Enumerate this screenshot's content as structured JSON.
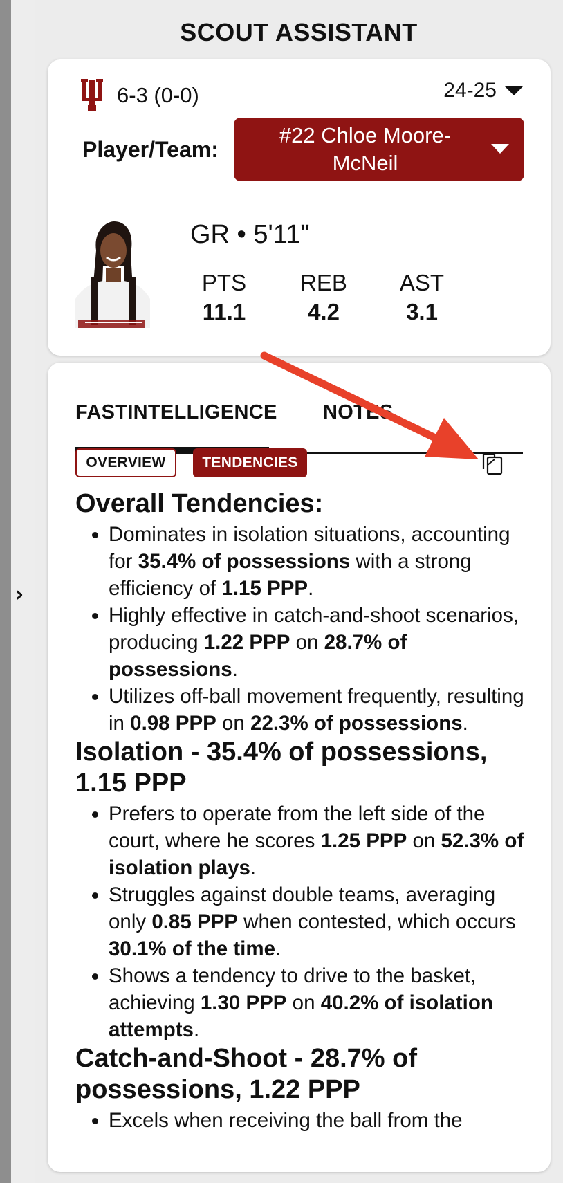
{
  "app": {
    "title": "SCOUT ASSISTANT"
  },
  "team": {
    "record": "6-3 (0-0)",
    "season": "24-25"
  },
  "player_select": {
    "label": "Player/Team:",
    "selected": "#22 Chloe Moore-McNeil"
  },
  "player": {
    "bio": "GR • 5'11\"",
    "stats": [
      {
        "label": "PTS",
        "value": "11.1"
      },
      {
        "label": "REB",
        "value": "4.2"
      },
      {
        "label": "AST",
        "value": "3.1"
      }
    ]
  },
  "tabs": {
    "fastintelligence": "FASTINTELLIGENCE",
    "notes": "NOTES"
  },
  "pills": {
    "overview": "OVERVIEW",
    "tendencies": "TENDENCIES"
  },
  "icons": {
    "team_logo": "indiana-trident-logo",
    "season_caret": "caret-down-icon",
    "select_caret": "caret-down-icon",
    "copy": "copy-icon",
    "expand": "chevron-right-icon"
  },
  "colors": {
    "brand": "#8f1413",
    "annotation_arrow": "#e8412a"
  },
  "sections": [
    {
      "heading": "Overall Tendencies:",
      "bullets": [
        [
          {
            "t": "Dominates in isolation situations, accounting for "
          },
          {
            "t": "35.4% of possessions",
            "b": true
          },
          {
            "t": " with a strong efficiency of "
          },
          {
            "t": "1.15 PPP",
            "b": true
          },
          {
            "t": "."
          }
        ],
        [
          {
            "t": "Highly effective in catch-and-shoot scenarios, producing "
          },
          {
            "t": "1.22 PPP",
            "b": true
          },
          {
            "t": " on "
          },
          {
            "t": "28.7% of possessions",
            "b": true
          },
          {
            "t": "."
          }
        ],
        [
          {
            "t": "Utilizes off-ball movement frequently, resulting in "
          },
          {
            "t": "0.98 PPP",
            "b": true
          },
          {
            "t": " on "
          },
          {
            "t": "22.3% of possessions",
            "b": true
          },
          {
            "t": "."
          }
        ]
      ]
    },
    {
      "heading": "Isolation - 35.4% of possessions, 1.15 PPP",
      "bullets": [
        [
          {
            "t": "Prefers to operate from the left side of the court, where he scores "
          },
          {
            "t": "1.25 PPP",
            "b": true
          },
          {
            "t": " on "
          },
          {
            "t": "52.3% of isolation plays",
            "b": true
          },
          {
            "t": "."
          }
        ],
        [
          {
            "t": "Struggles against double teams, averaging only "
          },
          {
            "t": "0.85 PPP",
            "b": true
          },
          {
            "t": " when contested, which occurs "
          },
          {
            "t": "30.1% of the time",
            "b": true
          },
          {
            "t": "."
          }
        ],
        [
          {
            "t": "Shows a tendency to drive to the basket, achieving "
          },
          {
            "t": "1.30 PPP",
            "b": true
          },
          {
            "t": " on "
          },
          {
            "t": "40.2% of isolation attempts",
            "b": true
          },
          {
            "t": "."
          }
        ]
      ]
    },
    {
      "heading": "Catch-and-Shoot - 28.7% of possessions, 1.22 PPP",
      "bullets": [
        [
          {
            "t": "Excels when receiving the ball from the"
          }
        ]
      ]
    }
  ]
}
